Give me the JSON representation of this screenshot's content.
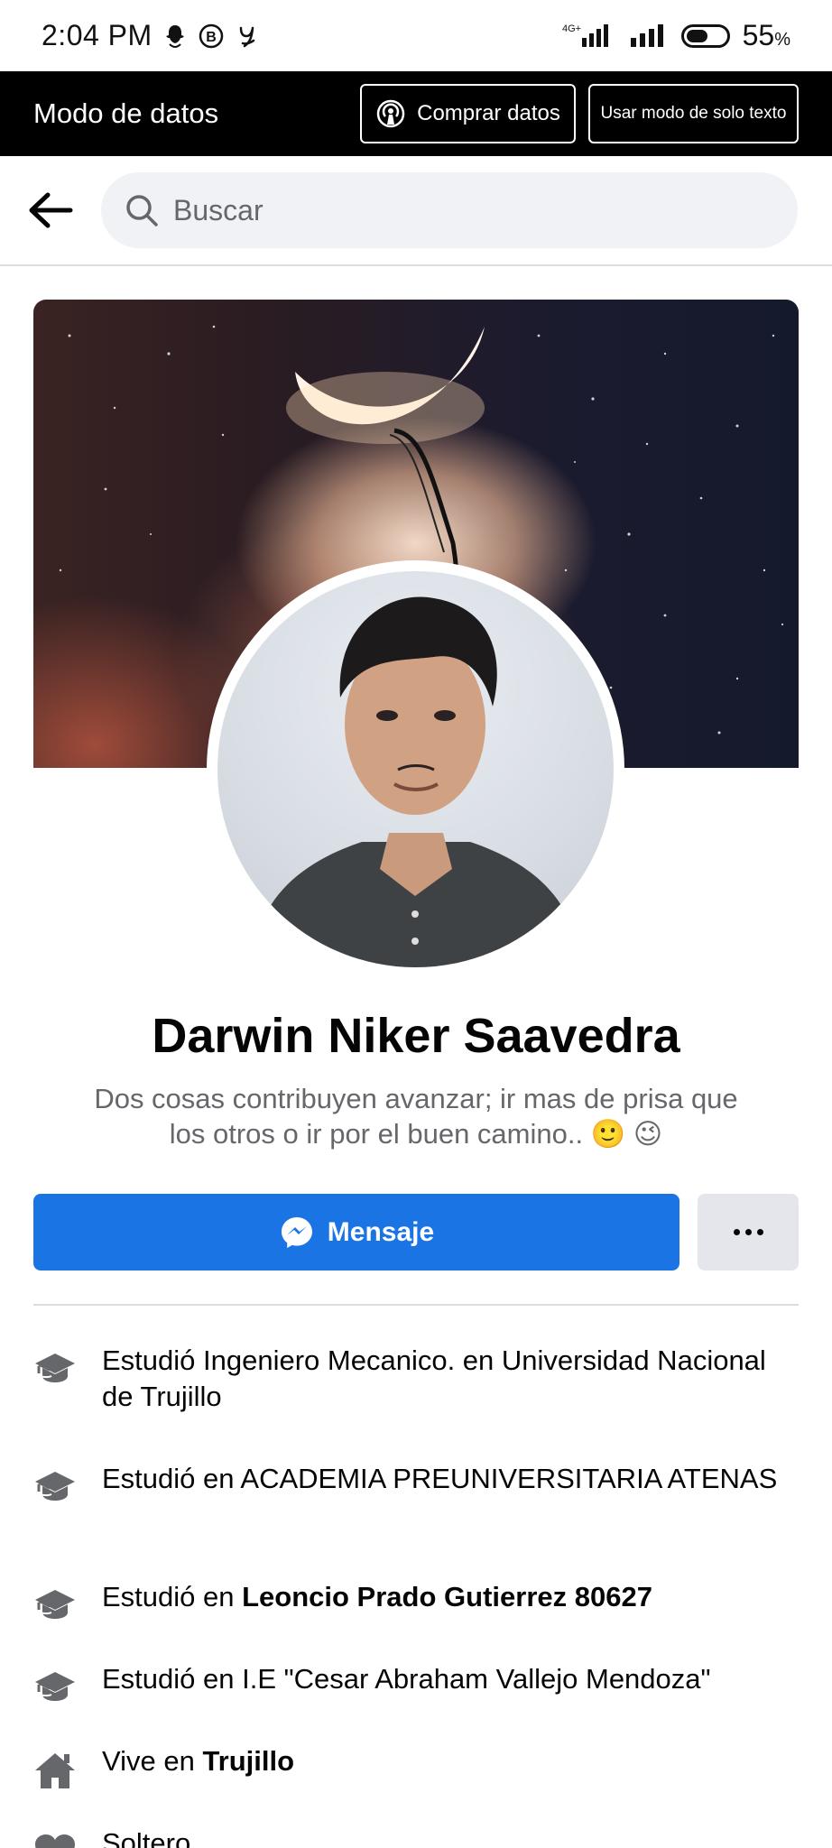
{
  "status_bar": {
    "time": "2:04 PM",
    "network": "4G+",
    "battery_percent": "55",
    "battery_unit": "%",
    "battery_level": 0.55
  },
  "data_mode_bar": {
    "title": "Modo de datos",
    "buy_button": "Comprar datos",
    "text_mode_button": "Usar modo de solo texto"
  },
  "search": {
    "placeholder": "Buscar"
  },
  "profile": {
    "name": "Darwin Niker Saavedra",
    "bio_line1": "Dos cosas contribuyen avanzar; ir mas de prisa que",
    "bio_line2": "los otros o ir por el buen camino.. 🙂 😉",
    "message_button": "Mensaje"
  },
  "intro": {
    "items": [
      {
        "icon": "graduation-cap-icon",
        "prefix": "Estudió Ingeniero Mecanico. en Universidad Nacional de Trujillo",
        "bold": ""
      },
      {
        "icon": "graduation-cap-icon",
        "prefix": "Estudió en ACADEMIA PREUNIVERSITARIA ATENAS",
        "bold": ""
      },
      {
        "icon": "graduation-cap-icon",
        "prefix": "Estudió en ",
        "bold": "Leoncio Prado Gutierrez 80627"
      },
      {
        "icon": "graduation-cap-icon",
        "prefix": "Estudió en I.E \"Cesar Abraham Vallejo Mendoza\"",
        "bold": ""
      },
      {
        "icon": "home-icon",
        "prefix": "Vive en ",
        "bold": "Trujillo"
      },
      {
        "icon": "heart-icon",
        "prefix": "Soltero",
        "bold": ""
      }
    ]
  },
  "colors": {
    "primary": "#1b74e4",
    "secondary_button": "#e4e6eb",
    "search_bg": "#f0f2f5",
    "muted_text": "#65676b",
    "icon_gray": "#65676b"
  }
}
